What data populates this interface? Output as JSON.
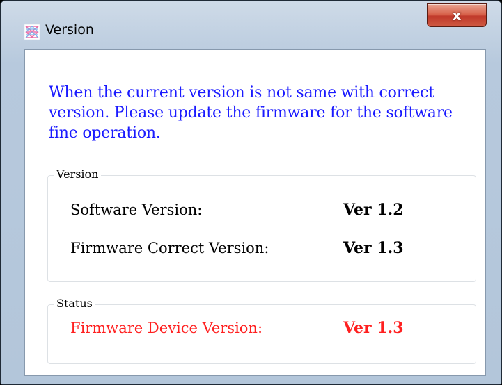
{
  "window": {
    "title": "Version",
    "close_label": "x"
  },
  "message": "When the current version is not same with correct version. Please update the firmware for the software fine operation.",
  "version_group": {
    "legend": "Version",
    "rows": [
      {
        "label": "Software Version:",
        "value": "Ver 1.2"
      },
      {
        "label": "Firmware Correct Version:",
        "value": "Ver 1.3"
      }
    ]
  },
  "status_group": {
    "legend": "Status",
    "rows": [
      {
        "label": "Firmware Device Version:",
        "value": "Ver 1.3"
      }
    ]
  },
  "colors": {
    "message": "#1a1aff",
    "status": "#ff2020"
  }
}
